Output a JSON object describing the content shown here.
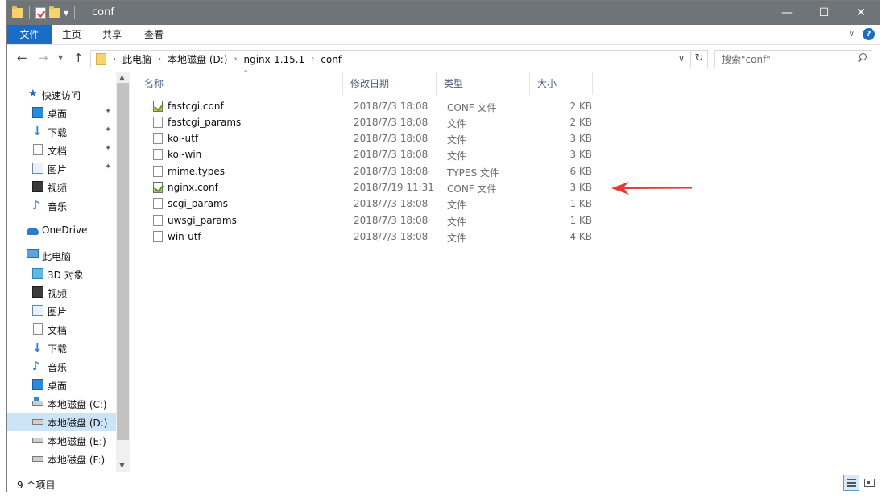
{
  "window": {
    "title": "conf",
    "controls": {
      "minimize": "—",
      "maximize": "☐",
      "close": "✕"
    }
  },
  "ribbon": {
    "tabs": [
      "文件",
      "主页",
      "共享",
      "查看"
    ]
  },
  "address": {
    "crumbs": [
      "此电脑",
      "本地磁盘 (D:)",
      "nginx-1.15.1",
      "conf"
    ],
    "search_placeholder": "搜索\"conf\""
  },
  "nav": {
    "items": [
      {
        "label": "快速访问",
        "icon": "star-icon",
        "pinned": false
      },
      {
        "label": "桌面",
        "icon": "desktop-icon",
        "pinned": true
      },
      {
        "label": "下载",
        "icon": "download-icon",
        "pinned": true
      },
      {
        "label": "文档",
        "icon": "document-icon",
        "pinned": true
      },
      {
        "label": "图片",
        "icon": "pictures-icon",
        "pinned": true
      },
      {
        "label": "视频",
        "icon": "video-icon",
        "pinned": false
      },
      {
        "label": "音乐",
        "icon": "music-icon",
        "pinned": false
      },
      {
        "label": "OneDrive",
        "icon": "onedrive-icon",
        "pinned": false
      },
      {
        "label": "此电脑",
        "icon": "this-pc-icon",
        "pinned": false
      },
      {
        "label": "3D 对象",
        "icon": "3d-objects-icon",
        "pinned": false
      },
      {
        "label": "视频",
        "icon": "video-icon",
        "pinned": false
      },
      {
        "label": "图片",
        "icon": "pictures-icon",
        "pinned": false
      },
      {
        "label": "文档",
        "icon": "document-icon",
        "pinned": false
      },
      {
        "label": "下载",
        "icon": "download-icon",
        "pinned": false
      },
      {
        "label": "音乐",
        "icon": "music-icon",
        "pinned": false
      },
      {
        "label": "桌面",
        "icon": "desktop-icon",
        "pinned": false
      },
      {
        "label": "本地磁盘 (C:)",
        "icon": "system-drive-icon",
        "pinned": false
      },
      {
        "label": "本地磁盘 (D:)",
        "icon": "drive-icon",
        "pinned": false,
        "selected": true
      },
      {
        "label": "本地磁盘 (E:)",
        "icon": "drive-icon",
        "pinned": false
      },
      {
        "label": "本地磁盘 (F:)",
        "icon": "drive-icon",
        "pinned": false
      }
    ]
  },
  "columns": {
    "name": "名称",
    "date": "修改日期",
    "type": "类型",
    "size": "大小"
  },
  "files": [
    {
      "name": "fastcgi.conf",
      "date": "2018/7/3 18:08",
      "type": "CONF 文件",
      "size": "2 KB",
      "icon": "conf-file-icon"
    },
    {
      "name": "fastcgi_params",
      "date": "2018/7/3 18:08",
      "type": "文件",
      "size": "2 KB",
      "icon": "file-icon"
    },
    {
      "name": "koi-utf",
      "date": "2018/7/3 18:08",
      "type": "文件",
      "size": "3 KB",
      "icon": "file-icon"
    },
    {
      "name": "koi-win",
      "date": "2018/7/3 18:08",
      "type": "文件",
      "size": "3 KB",
      "icon": "file-icon"
    },
    {
      "name": "mime.types",
      "date": "2018/7/3 18:08",
      "type": "TYPES 文件",
      "size": "6 KB",
      "icon": "file-icon"
    },
    {
      "name": "nginx.conf",
      "date": "2018/7/19 11:31",
      "type": "CONF 文件",
      "size": "3 KB",
      "icon": "conf-file-icon"
    },
    {
      "name": "scgi_params",
      "date": "2018/7/3 18:08",
      "type": "文件",
      "size": "1 KB",
      "icon": "file-icon"
    },
    {
      "name": "uwsgi_params",
      "date": "2018/7/3 18:08",
      "type": "文件",
      "size": "1 KB",
      "icon": "file-icon"
    },
    {
      "name": "win-utf",
      "date": "2018/7/3 18:08",
      "type": "文件",
      "size": "4 KB",
      "icon": "file-icon"
    }
  ],
  "status": {
    "item_count": "9 个项目"
  },
  "colors": {
    "accent": "#1a6cc4",
    "titlebar": "#6f7479",
    "selected": "#cce4f7",
    "arrow": "#e53935"
  }
}
